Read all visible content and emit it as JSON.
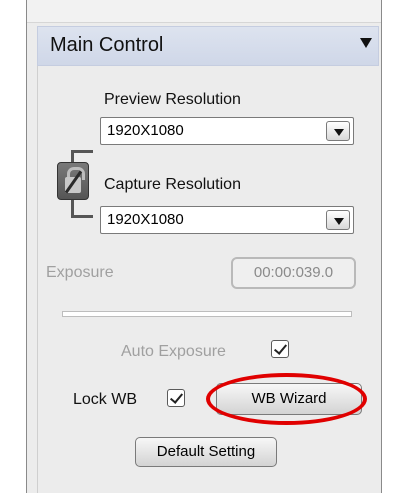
{
  "panel": {
    "title": "Main Control"
  },
  "preview_resolution": {
    "label": "Preview Resolution",
    "value": "1920X1080"
  },
  "capture_resolution": {
    "label": "Capture Resolution",
    "value": "1920X1080"
  },
  "exposure": {
    "label": "Exposure",
    "time": "00:00:039.0"
  },
  "auto_exposure": {
    "label": "Auto Exposure",
    "checked": true
  },
  "lock_wb": {
    "label": "Lock WB",
    "checked": true
  },
  "buttons": {
    "wb_wizard": "WB Wizard",
    "default_setting": "Default Setting"
  },
  "colors": {
    "highlight": "#e00000",
    "header": "#d6ddec"
  }
}
